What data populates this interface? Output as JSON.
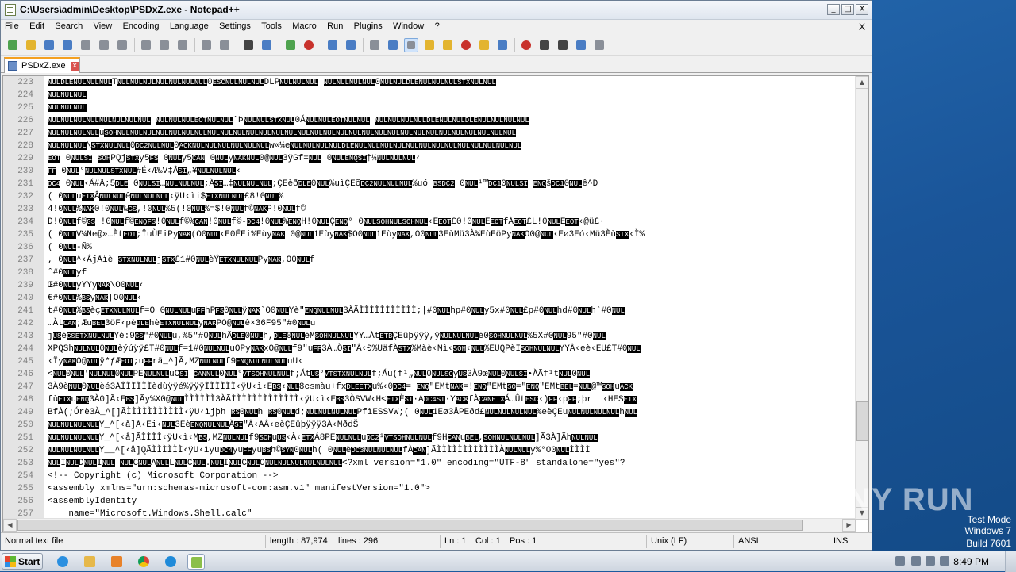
{
  "window": {
    "title": "C:\\Users\\admin\\Desktop\\PSDxZ.exe - Notepad++",
    "controls": [
      "_",
      "□",
      "X"
    ]
  },
  "menu": [
    "File",
    "Edit",
    "Search",
    "View",
    "Encoding",
    "Language",
    "Settings",
    "Tools",
    "Macro",
    "Run",
    "Plugins",
    "Window",
    "?"
  ],
  "menu_close": "X",
  "tab": {
    "label": "PSDxZ.exe",
    "close": "x"
  },
  "lines": [
    {
      "n": "223",
      "t": "NULDLENULNULNULTNULNULNULNULNULNULNUL0ESCNULNULNULDLPNULNULNUL NULNULNULNUL0NULNULDLENULNULNULSTXNULNUL"
    },
    {
      "n": "224",
      "t": "NULNULNUL"
    },
    {
      "n": "225",
      "t": "NULNULNUL"
    },
    {
      "n": "226",
      "t": "NULNULNULNULNULNULNULNUL NULNULNULEOTNULNUL`ÞNULNULSTXNUL0ÁNULNULEOTNULNUL NULNULNULNULDLENULNULDLENULNULNULNUL"
    },
    {
      "n": "227",
      "t": "NULNULNULNULuSOHNULNULNULNULNULNULNULNULNULNULNULNULNULNULNULNULNULNULNULNULNULNULNULNULNULNULNULNULNULNULNUL"
    },
    {
      "n": "228",
      "t": "NULNULNUL\\STXNULNUL0DC2NULNUL0ACKNULNULNULNULNULNULw«¼eNULNULNULNULDLENULNULNULNULNULNULNULNULNULNULNULNULNUL"
    },
    {
      "n": "229",
      "t": "EOT 0NULSI SOHPQjSTXy5FS 0NULy5CAN 0NULyNAKNUL0@NUL3ÿGf=NUL 0NULENQSI†¼NULNULNUL‹"
    },
    {
      "n": "230",
      "t": "FF 0NUL°NULNULSTXNUL#É‹Æ‰V‡ÂSI„¥NULNULNUL‹"
    },
    {
      "n": "231",
      "t": "DC4 0NUL‹Á#Å;5DLE 0NULSI…NULNULNUL;ÀSI…‡NULNULNUL;ÇEèðDLE0NUL%uìÇEõDC2NULNULNUL%uó BSDC2 0NUL¹™DC10NULSI ENQšDC10NULê^D"
    },
    {
      "n": "232",
      "t": "( 0NULuETXÂNULNULêNULNULNUL‹ÿU‹ìi$ETXNULNUL£8!0NUL%"
    },
    {
      "n": "233",
      "t": "4!0NUL%NAK0!0NUL‰GS,!0NUL%5(!0NUL%=$!0NULf©NAKP!0NULf©"
    },
    {
      "n": "234",
      "t": "D!0NULf©GS !0NULf©ENQFS!0NULf©%CAN!0NULf©-DC4!0NUL%ENQH!0NULÇENQ° 0NULSOHNULSOHNUL‹EEOT£0!0NULEEOTfÀEOT£L!0NULEEOT‹@ü£·"
    },
    {
      "n": "235",
      "t": "( 0NULV¼Ne@»…ÈtEOT;ÎuÙEiPyNAK(O0NUL‹E0ËEi%EùyNAK 0@NUL1EùyNAK$O0NUL1EùyNAK,O0NUL3EùMü3À%EùEöPyNAKO0@NUL‹Eø3Eó‹Mü3ÈùSTX‹Ì%"
    },
    {
      "n": "236",
      "t": "( 0NUL-Ñ%"
    },
    {
      "n": "237",
      "t": ", 0NUL^‹ÂjÃïè STXNULNULjSTX£1#0NULèÝETXNULNULPyNAK,O0NULf"
    },
    {
      "n": "238",
      "t": "ˆ#0NULyf"
    },
    {
      "n": "239",
      "t": "Œ#0NULyYYyNAK\\O0NUL‹"
    },
    {
      "n": "240",
      "t": "€#0NUL%BSyNAK|O0NUL‹"
    },
    {
      "n": "241",
      "t": "t#0NUL%BSèçETXNULNULf=O 0NULNULuFFhPFS0NULÿNAK`O0NULYè\"ENQNULNUL3ÀÃÌÌÌÌÌÌÌÌÌÌÌ;|#0NULhp#0NULy5x#0NUL£p#0NULhd#0NULh`#0NUL"
    },
    {
      "n": "242",
      "t": "…ÀtCAN;ÆuBEL3öF‹pèDLEhèETXNULNULyNAKPO@NULê×36F95\"#0NULu"
    },
    {
      "n": "243",
      "t": "jUSèGSETXNULNULYè:9GS\"#0NULu,%5\"#0NULhÄDLE0NULh,DLE0NULèMSOHNULNULYY…ÀtETBÇEüþÿÿÿ,ÿNULNULNULé0SOHNULNUL%5X#0NUL95\"#0NUL"
    },
    {
      "n": "244",
      "t": "XPQShNULNUL0NULèýúÿÿ£T#0NULf=1#0NULNULuOPyNAKxO@NULf9\"uFF3À…ÒSI\"Â‹Ð%UäfÀSTX%Màè‹Mì‹SOH‹NUL%EÜQPèISOHNULNULYYÂ‹eè‹EÜ£T#0NUL"
    },
    {
      "n": "245",
      "t": "‹ÏyNAKO@NULÿ*ƒÆEOT;uFFrä_^]Ã,MZNULNULf9ENQNULNULNULuU‹"
    },
    {
      "n": "246",
      "t": "<NUL0NUL'NULNUL0NULPENULNULuCSI CANNUL0NUL°VTSOHNULNULf;ÁtUS°VTSTXNULNULf;Áu(f¹„NUL0NULSOyUS3À9œNUL0NULSI•ÀÃf¹tNUL0NUL"
    },
    {
      "n": "247",
      "t": "3À9èNUL0NULèé3ÀÎÌÌÌÌÌèdùÿÿé%ÿÿÿÌÌÌÌÌÌ‹ÿU‹ì‹EBS‹NUL8csmàu+fxDLEETXu%‹0DC4= ENQ\"EMtNAK=!ENQ\"EMtSO=\"ENQ\"EMtBEL=NUL@™SOHuACK"
    },
    {
      "n": "248",
      "t": "fùETXuENQ3À0]Ã‹EBS]Ãy%X0@NULÌÌÌÌÌÌ3ÀÃÌÌÌÌÌÌÌÌÌÌÌÌÌ‹ÿU‹ì‹EBS3ÒSVW‹H<ETXÈSI·ADC4SI·YACKfÀCANETXÁ…ÛtESC‹)FF‹pFF;þr  ‹HESETX"
    },
    {
      "n": "249",
      "t": "BfÀ(;Órè3À_^[]ÃÌÌÌÌÌÌÌÌÌÌÌ‹ÿU‹ìjþh RS0NULh RS0NULd;NULNULNULNULPfìESSVW;( 0NUL1Eø3ÅPEðd£NULNULNULNUL%eèÇEuNULNULNULNULhNUL"
    },
    {
      "n": "250",
      "t": "NULNULNULNULY_^[‹å]Ã‹Ei‹NUL3EèENQNULNULÀSI\"Â‹ÄÂ‹eèÇEüþÿÿÿ3À‹MðdŠ"
    },
    {
      "n": "251",
      "t": "NULNULNULNULY_^[‹å]ÃÌÌÌÌ‹ÿU‹ì‹MBS,MZNULNULf9SOHuUS‹À‹ETXÁ8PENULNULuDC2¹VTSOHNULNULf9HCANuBEL,SOHNULNULNUL]Ã3À]ÃhNULNUL"
    },
    {
      "n": "252",
      "t": "NULNULNULNULY__^[‹å]QÃÌÌÌÌÌÌ‹ÿU‹ìyuDC4yuFFyuBSh©SYN0NULh( 0NULèDC3NULNULNULfÀCAN]ÃÌÌÌÌÌÌÌÌÌÌÌÌÀNULNULy%°O0NULÌÌÌÌ"
    },
    {
      "n": "253",
      "t": "NULINULDNULINUL NULCNULANULLNULCNUL.NULINULCNULONULNULNULNULNULNUL<?xml version=\"1.0\" encoding=\"UTF-8\" standalone=\"yes\"?"
    },
    {
      "n": "254",
      "t": "<!-- Copyright (c) Microsoft Corporation -->"
    },
    {
      "n": "255",
      "t": "<assembly xmlns=\"urn:schemas-microsoft-com:asm.v1\" manifestVersion=\"1.0\">"
    },
    {
      "n": "256",
      "t": "<assemblyIdentity"
    },
    {
      "n": "257",
      "t": "    name=\"Microsoft.Windows.Shell.calc\""
    }
  ],
  "status": {
    "type": "Normal text file",
    "length": "length : 87,974",
    "lines": "lines : 296",
    "ln": "Ln : 1",
    "col": "Col : 1",
    "pos": "Pos : 1",
    "eol": "Unix (LF)",
    "encoding": "ANSI",
    "mode": "INS"
  },
  "taskbar": {
    "start_label": "Start",
    "clock": "8:49 PM"
  },
  "overlay": {
    "watermark": "ANY RUN",
    "test_mode": "Test Mode",
    "os_name": "Windows 7",
    "build": "Build 7601"
  },
  "colors": {
    "control_char_bg": "#000000",
    "control_char_fg": "#ffffff",
    "tab_accent": "#f4a020"
  }
}
